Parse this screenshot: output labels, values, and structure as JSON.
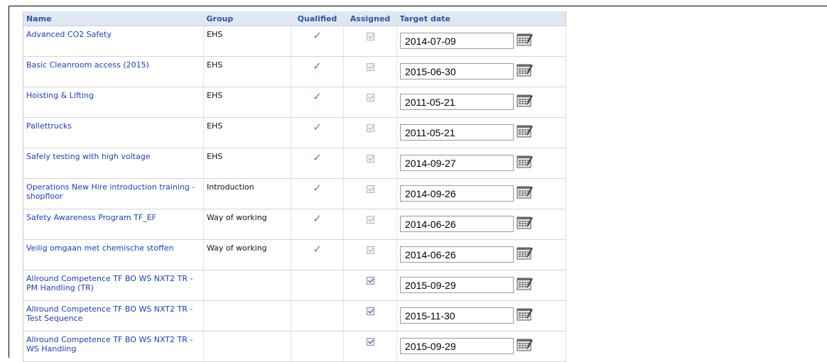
{
  "columns": {
    "name": "Name",
    "group": "Group",
    "qualified": "Qualified",
    "assigned": "Assigned",
    "target_date": "Target date"
  },
  "rows": [
    {
      "name": "Advanced CO2 Safety",
      "group": "EHS",
      "qualified": "✓",
      "assigned": true,
      "assigned_enabled": false,
      "target_date": "2014-07-09"
    },
    {
      "name": "Basic Cleanroom access (2015)",
      "group": "EHS",
      "qualified": "✓",
      "assigned": true,
      "assigned_enabled": false,
      "target_date": "2015-06-30"
    },
    {
      "name": "Hoisting & Lifting",
      "group": "EHS",
      "qualified": "✓",
      "assigned": true,
      "assigned_enabled": false,
      "target_date": "2011-05-21"
    },
    {
      "name": "Pallettrucks",
      "group": "EHS",
      "qualified": "✓",
      "assigned": true,
      "assigned_enabled": false,
      "target_date": "2011-05-21"
    },
    {
      "name": "Safely testing with high voltage",
      "group": "EHS",
      "qualified": "✓",
      "assigned": true,
      "assigned_enabled": false,
      "target_date": "2014-09-27"
    },
    {
      "name": "Operations New Hire introduction training - shopfloor",
      "group": "Introduction",
      "qualified": "✓",
      "assigned": true,
      "assigned_enabled": false,
      "target_date": "2014-09-26"
    },
    {
      "name": "Safety Awareness Program TF_EF",
      "group": "Way of working",
      "qualified": "✓",
      "assigned": true,
      "assigned_enabled": false,
      "target_date": "2014-06-26"
    },
    {
      "name": "Veilig omgaan met chemische stoffen",
      "group": "Way of working",
      "qualified": "✓",
      "assigned": true,
      "assigned_enabled": false,
      "target_date": "2014-06-26"
    },
    {
      "name": "Allround Competence TF BO WS NXT2 TR - PM Handling (TR)",
      "group": "",
      "qualified": "",
      "assigned": true,
      "assigned_enabled": true,
      "target_date": "2015-09-29"
    },
    {
      "name": "Allround Competence TF BO WS NXT2 TR - Test Sequence",
      "group": "",
      "qualified": "",
      "assigned": true,
      "assigned_enabled": true,
      "target_date": "2015-11-30"
    },
    {
      "name": "Allround Competence TF BO WS NXT2 TR - WS Handling",
      "group": "",
      "qualified": "",
      "assigned": true,
      "assigned_enabled": true,
      "target_date": "2015-09-29"
    }
  ],
  "icons": {
    "qualified": "check-icon",
    "calendar": "calendar-icon"
  },
  "colors": {
    "header_bg": "#dfe7f2",
    "header_text": "#2b56a8",
    "link": "#1a3eb8",
    "check": "#3fa52b"
  }
}
